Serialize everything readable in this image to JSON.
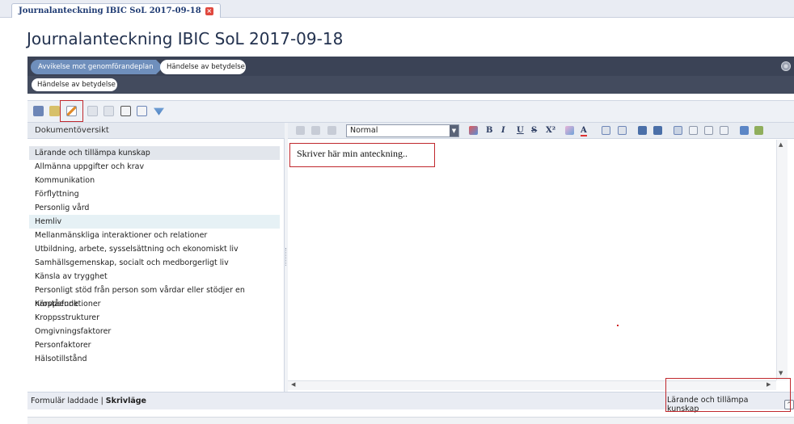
{
  "doc_tab": {
    "label": "Journalanteckning IBIC SoL 2017-09-18",
    "close": "×"
  },
  "page_title": "Journalanteckning IBIC SoL 2017-09-18",
  "breadcrumbs": {
    "step1": "Avvikelse mot genomförandeplan",
    "step2": "Händelse av betydelse",
    "sub": "Händelse av betydelse"
  },
  "left_panel": {
    "header": "Dokumentöversikt",
    "items": [
      "Lärande och tillämpa kunskap",
      "Allmänna uppgifter och krav",
      "Kommunikation",
      "Förflyttning",
      "Personlig vård",
      "Hemliv",
      "Mellanmänskliga interaktioner och relationer",
      "Utbildning, arbete, sysselsättning och ekonomiskt liv",
      "Samhällsgemenskap, socialt och medborgerligt liv",
      "Känsla av trygghet",
      "Personligt stöd från person som vårdar eller stödjer en närstående",
      "Kroppsfunktioner",
      "Kroppsstrukturer",
      "Omgivningsfaktorer",
      "Personfaktorer",
      "Hälsotillstånd"
    ]
  },
  "editor": {
    "style_value": "Normal",
    "content": "Skriver här min anteckning..",
    "buttons": {
      "bold": "B",
      "italic": "I",
      "underline": "U",
      "strike": "S",
      "superscript": "X²",
      "font_color": "A"
    }
  },
  "status": {
    "left_prefix": "Formulär laddade | ",
    "left_mode": "Skrivläge",
    "right": "Lärande och tillämpa kunskap",
    "up_glyph": "^"
  },
  "colors": {
    "accent": "#c0282d",
    "crumb_active": "#6f8fbc",
    "bar": "#3b4356"
  }
}
